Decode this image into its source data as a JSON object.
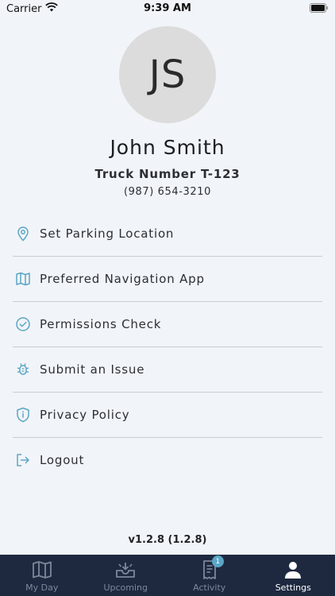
{
  "status_bar": {
    "carrier": "Carrier",
    "time": "9:39 AM"
  },
  "profile": {
    "initials": "JS",
    "name": "John Smith",
    "truck": "Truck Number T-123",
    "phone": "(987) 654-3210"
  },
  "menu": {
    "items": [
      {
        "label": "Set Parking Location",
        "icon": "location-pin-icon"
      },
      {
        "label": "Preferred Navigation App",
        "icon": "map-icon"
      },
      {
        "label": "Permissions Check",
        "icon": "check-circle-icon"
      },
      {
        "label": "Submit an Issue",
        "icon": "bug-icon"
      },
      {
        "label": "Privacy Policy",
        "icon": "shield-icon"
      },
      {
        "label": "Logout",
        "icon": "logout-icon"
      }
    ]
  },
  "version": "v1.2.8 (1.2.8)",
  "tab_bar": {
    "tabs": [
      {
        "label": "My Day",
        "icon": "map-icon"
      },
      {
        "label": "Upcoming",
        "icon": "inbox-icon"
      },
      {
        "label": "Activity",
        "icon": "receipt-icon",
        "badge": "1"
      },
      {
        "label": "Settings",
        "icon": "person-icon",
        "active": true
      }
    ]
  },
  "colors": {
    "background": "#f1f4f8",
    "accent_icon": "#5aa6c6",
    "tab_bar_bg": "#1e2940",
    "tab_inactive": "#7f8798",
    "tab_active": "#ffffff"
  }
}
